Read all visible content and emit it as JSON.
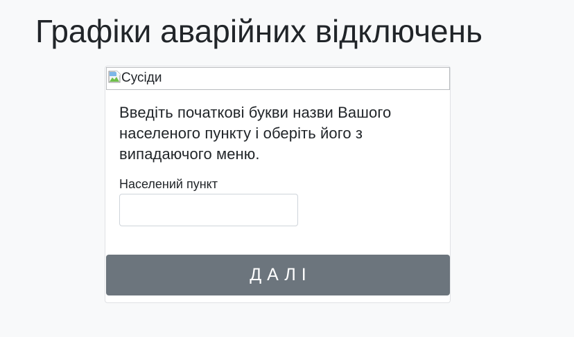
{
  "page": {
    "title": "Графіки аварійних відключень"
  },
  "card": {
    "image_alt": "Сусіди",
    "intro": "Введіть початкові букви назви Вашого населеного пункту і оберіть його з випадаючого меню.",
    "locality_field": {
      "label": "Населений пункт",
      "value": "",
      "placeholder": ""
    },
    "next_button_label": "ДАЛІ"
  },
  "icons": {
    "broken_image": "broken-image-icon"
  },
  "colors": {
    "page_background": "#f8f9fa",
    "card_background": "#ffffff",
    "button_background": "#6c757d",
    "button_text": "#ffffff",
    "text": "#212529"
  }
}
